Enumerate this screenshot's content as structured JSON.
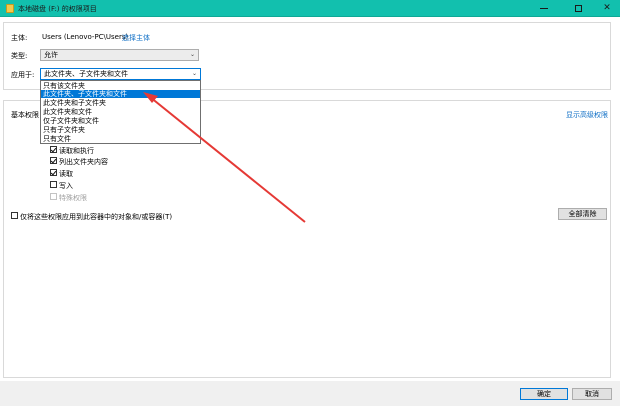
{
  "window": {
    "title": "本地磁盘 (F:) 的权限项目",
    "icon": "folder-icon"
  },
  "principal": {
    "label": "主体:",
    "value": "Users (Lenovo-PC\\Users)",
    "select_link": "选择主体"
  },
  "type": {
    "label": "类型:",
    "value": "允许"
  },
  "applies_to": {
    "label": "应用于:",
    "value": "此文件夹、子文件夹和文件",
    "options": [
      "只有该文件夹",
      "此文件夹、子文件夹和文件",
      "此文件夹和子文件夹",
      "此文件夹和文件",
      "仅子文件夹和文件",
      "只有子文件夹",
      "只有文件"
    ],
    "selected_index": 1
  },
  "basic_permissions": {
    "label": "基本权限",
    "advanced_link": "显示高级权限",
    "items": [
      {
        "label": "读取和执行",
        "checked": true
      },
      {
        "label": "列出文件夹内容",
        "checked": true
      },
      {
        "label": "读取",
        "checked": true
      },
      {
        "label": "写入",
        "checked": false
      },
      {
        "label": "特殊权限",
        "checked": false,
        "disabled": true
      }
    ]
  },
  "apply_only": {
    "label": "仅将这些权限应用到此容器中的对象和/或容器(T)"
  },
  "buttons": {
    "clear_all": "全部清除",
    "ok": "确定",
    "cancel": "取消"
  },
  "colors": {
    "titlebar": "#12c0ae",
    "selection": "#0078d7",
    "link": "#0f6fc6",
    "arrow": "#e53935"
  }
}
